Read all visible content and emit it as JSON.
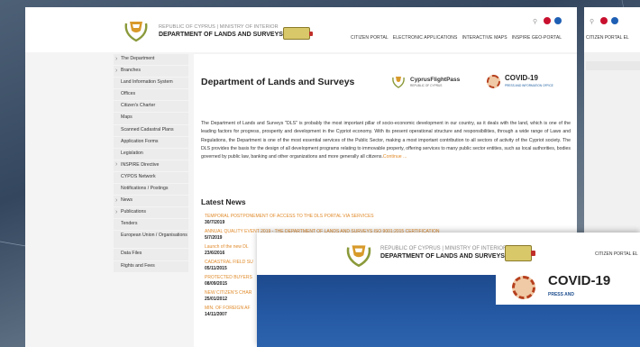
{
  "header": {
    "org_line1": "REPUBLIC OF CYPRUS | MINISTRY OF INTERIOR",
    "org_line2": "DEPARTMENT OF LANDS AND SURVEYS",
    "nav": [
      "CITIZEN PORTAL",
      "ELECTRONIC APPLICATIONS",
      "INTERACTIVE MAPS",
      "INSPIRE GEO-PORTAL"
    ]
  },
  "sidebar": {
    "items": [
      {
        "label": "The Department",
        "arrow": true
      },
      {
        "label": "Branches",
        "arrow": true
      },
      {
        "label": "Land Information System",
        "arrow": false
      },
      {
        "label": "Offices",
        "arrow": false
      },
      {
        "label": "Citizen's Charter",
        "arrow": false
      },
      {
        "label": "Maps",
        "arrow": false
      },
      {
        "label": "Scanned Cadastral Plans",
        "arrow": false
      },
      {
        "label": "Application Forms",
        "arrow": false
      },
      {
        "label": "Legislation",
        "arrow": false
      },
      {
        "label": "INSPIRE Directive",
        "arrow": true
      },
      {
        "label": "CYPOS Network",
        "arrow": false
      },
      {
        "label": "Notifications / Postings",
        "arrow": false
      },
      {
        "label": "News",
        "arrow": true
      },
      {
        "label": "Publications",
        "arrow": true
      },
      {
        "label": "Tenders",
        "arrow": false
      },
      {
        "label": "European Union / Organisations",
        "arrow": false,
        "tall": true
      },
      {
        "label": "Data Files",
        "arrow": false
      },
      {
        "label": "Rights and Fees",
        "arrow": false
      }
    ]
  },
  "main": {
    "title": "Department of Lands and Surveys",
    "flightpass_name": "CyprusFlightPass",
    "flightpass_sub": "REPUBLIC OF CYPRUS",
    "covid_name": "COVID-19",
    "covid_sub": "PRESS AND INFORMATION OFFICE",
    "intro": "The Department of Lands and Surveys \"DLS\" is probably the most important pillar of socio-economic development in our country, as it deals with the land, which is one of the leading factors for progress, prosperity and development in the Cypriot economy. With its present operational structure and responsibilities, through a wide range of Laws and Regulations, the Department is one of the most essential services of the Public Sector, making a most important contribution to all sectors of activity of the Cypriot society. The DLS provides the basis for the design of all development programs relating to immovable property, offering services to many public sector entities, such as local authorities, bodies governed by public law, banking and other organizations and more generally all citizens.",
    "continue": "Continue ...",
    "news_heading": "Latest News",
    "news": [
      {
        "title": "TEMPORAL POSTPONEMENT OF ACCESS TO THE DLS PORTAL VIA SERVICES",
        "date": "30/7/2019"
      },
      {
        "title": "ANNUAL QUALITY EVENT 2019 - THE DEPARTMENT OF LANDS AND SURVEYS ISO 9001:2015 CERTIFICATION",
        "date": "5/7/2019"
      },
      {
        "title": "Launch of the new DL",
        "date": "23/6/2016"
      },
      {
        "title": "CADASTRAL FIELD SU",
        "date": "05/11/2015"
      },
      {
        "title": "PROTECTED BUYERS",
        "date": "08/09/2015"
      },
      {
        "title": "NEW CITIZEN'S CHAR",
        "date": "25/01/2012"
      },
      {
        "title": "MIN. OF FOREIGN AF",
        "date": "14/11/2007"
      }
    ]
  },
  "right_page": {
    "nav_partial": "CITIZEN PORTAL  EL"
  },
  "overlay": {
    "org_line1": "REPUBLIC OF CYPRUS | MINISTRY OF INTERIOR",
    "org_line2": "DEPARTMENT OF LANDS AND SURVEYS",
    "nav_partial": "CITIZEN PORTAL  EL",
    "covid_name": "COVID-19",
    "covid_sub": "PRESS AND"
  },
  "colors": {
    "accent": "#e08a2a",
    "hero_blue": "#2559a3"
  }
}
